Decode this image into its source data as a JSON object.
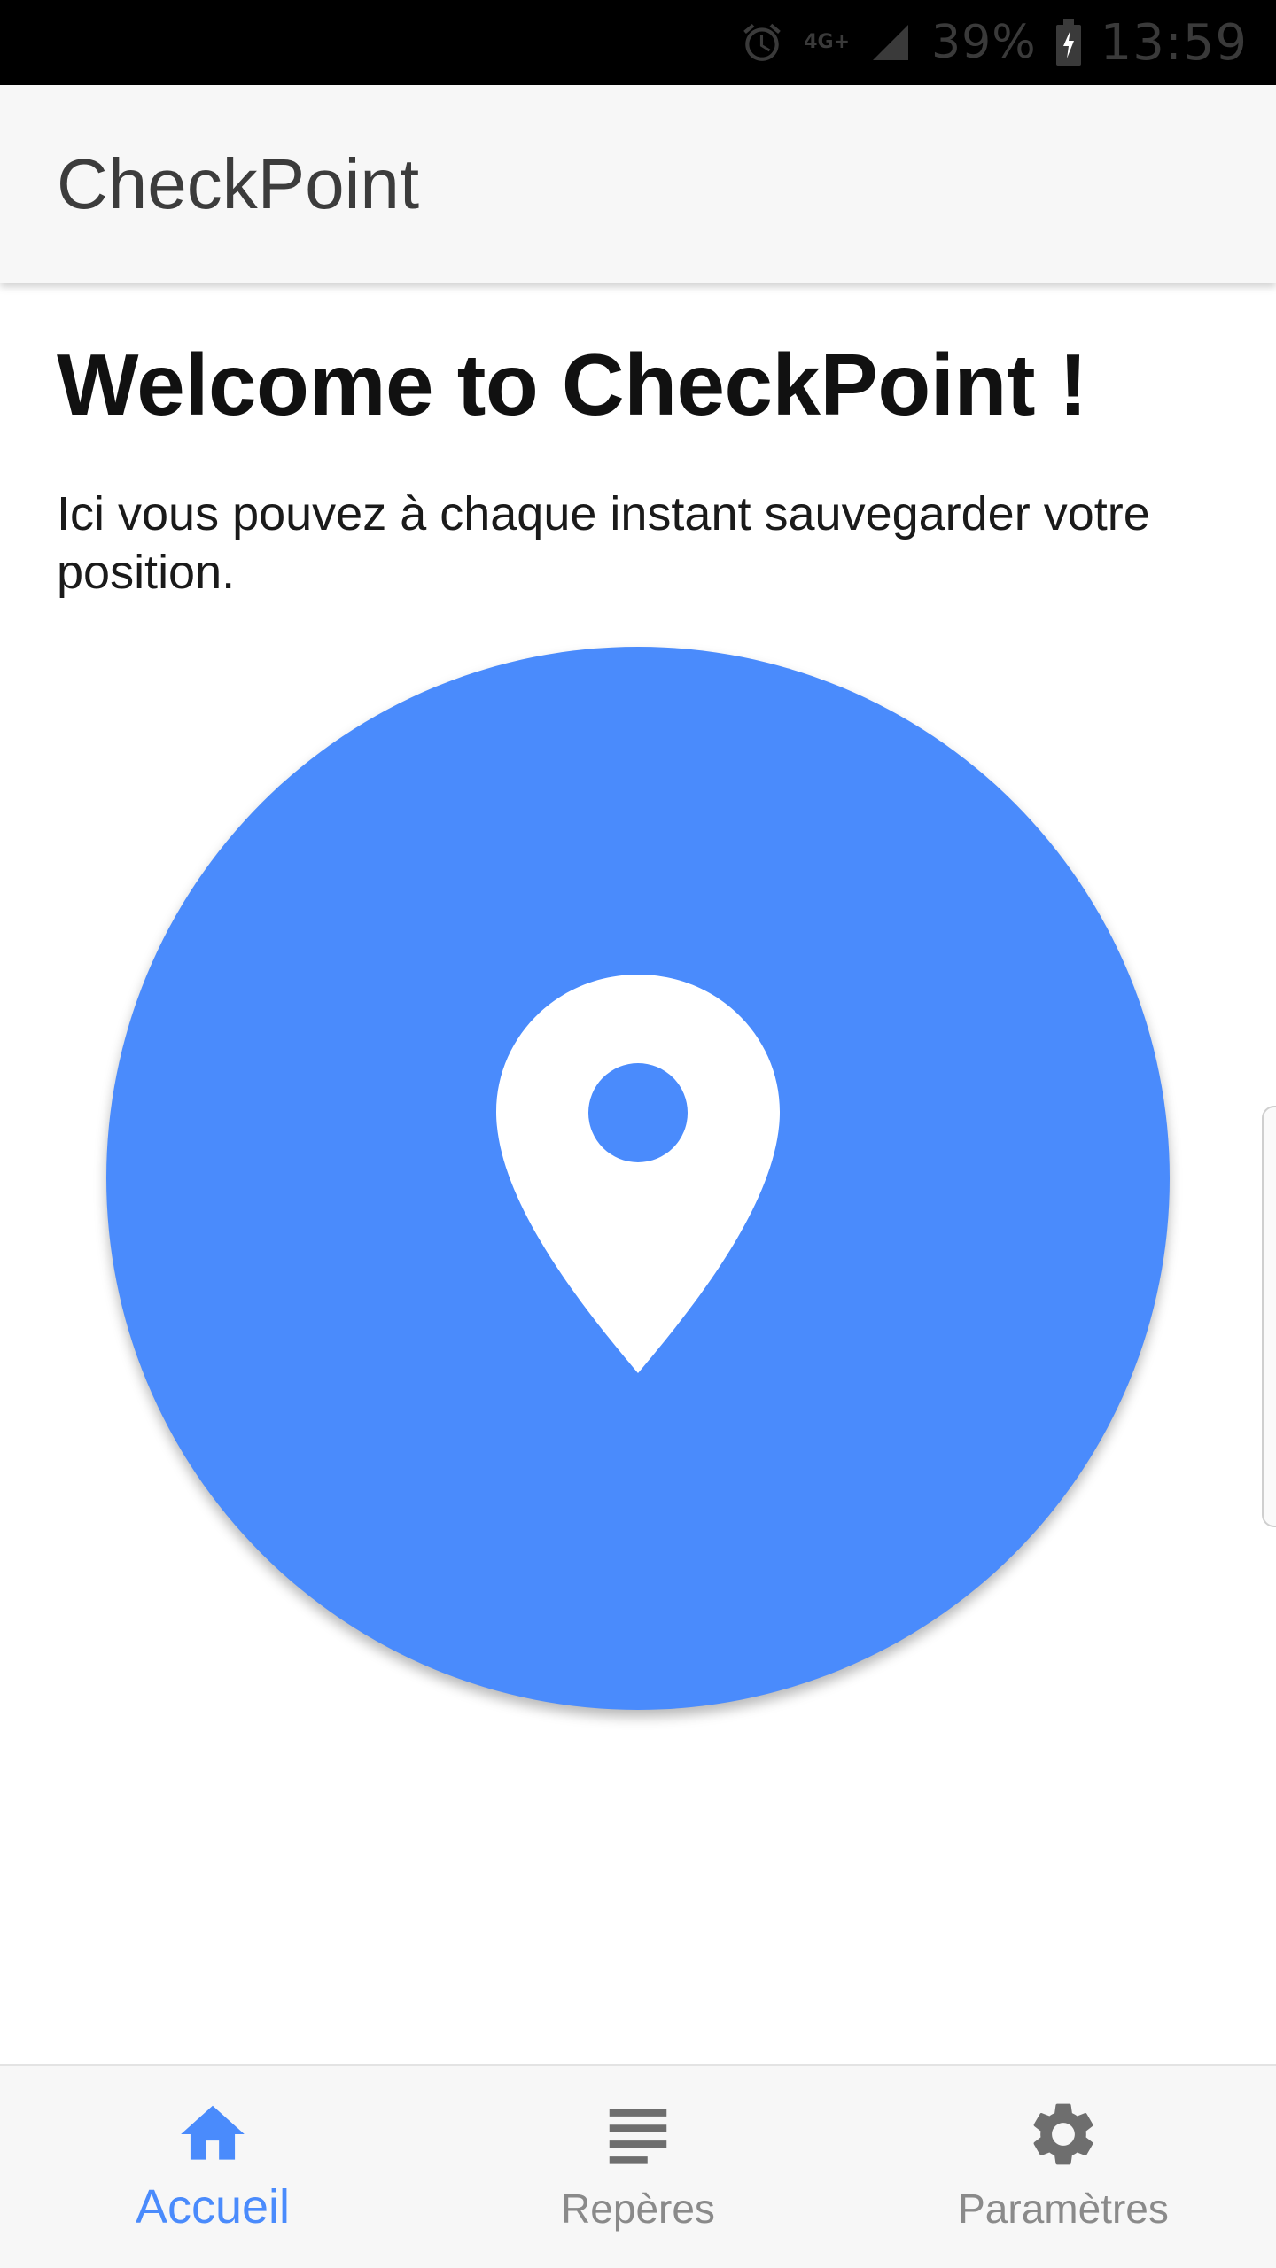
{
  "status_bar": {
    "network": "4G+",
    "battery": "39%",
    "time": "13:59"
  },
  "app_bar": {
    "title": "CheckPoint"
  },
  "main": {
    "heading": "Welcome to CheckPoint !",
    "intro": "Ici vous pouvez à chaque instant sauvegarder votre position.",
    "checkpoint_button": {
      "icon": "location-pin-icon",
      "color": "#4a8bfc"
    }
  },
  "bottom_nav": {
    "active_color": "#4a8bfc",
    "items": [
      {
        "label": "Accueil",
        "icon": "home-icon",
        "active": true
      },
      {
        "label": "Repères",
        "icon": "list-icon",
        "active": false
      },
      {
        "label": "Paramètres",
        "icon": "gear-icon",
        "active": false
      }
    ]
  }
}
